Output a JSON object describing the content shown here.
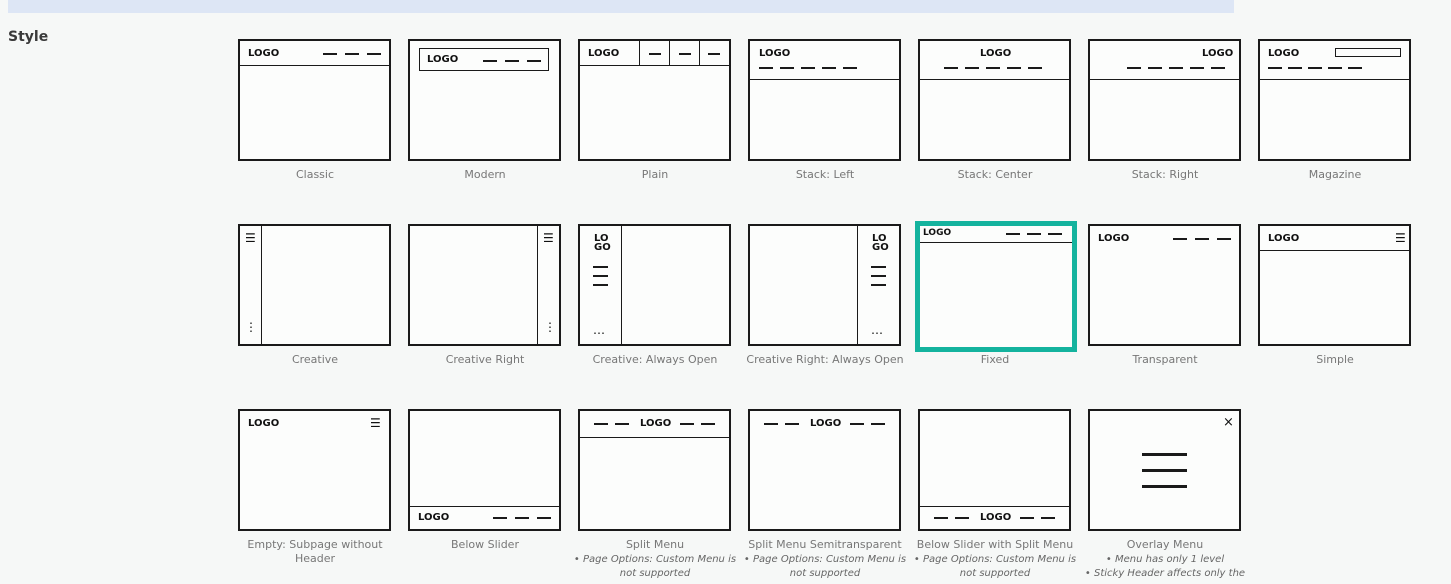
{
  "section": {
    "title": "Style"
  },
  "thumb_logo": "LOGO",
  "thumb_logo_split": [
    "LO",
    "GO"
  ],
  "styles": [
    {
      "id": "classic",
      "label": "Classic"
    },
    {
      "id": "modern",
      "label": "Modern"
    },
    {
      "id": "plain",
      "label": "Plain"
    },
    {
      "id": "stack-left",
      "label": "Stack: Left"
    },
    {
      "id": "stack-center",
      "label": "Stack: Center"
    },
    {
      "id": "stack-right",
      "label": "Stack: Right"
    },
    {
      "id": "magazine",
      "label": "Magazine"
    },
    {
      "id": "creative",
      "label": "Creative"
    },
    {
      "id": "creative-right",
      "label": "Creative Right"
    },
    {
      "id": "creative-always-open",
      "label": "Creative: Always Open"
    },
    {
      "id": "creative-right-always-open",
      "label": "Creative Right: Always Open"
    },
    {
      "id": "fixed",
      "label": "Fixed",
      "selected": true
    },
    {
      "id": "transparent",
      "label": "Transparent"
    },
    {
      "id": "simple",
      "label": "Simple"
    },
    {
      "id": "empty-subpage",
      "label": "Empty: Subpage without",
      "label2": "Header"
    },
    {
      "id": "below-slider",
      "label": "Below Slider"
    },
    {
      "id": "split-menu",
      "label": "Split Menu",
      "notes": [
        "• Page Options: Custom Menu is",
        "not supported"
      ]
    },
    {
      "id": "split-menu-semitransparent",
      "label": "Split Menu Semitransparent",
      "notes": [
        "• Page Options: Custom Menu is",
        "not supported"
      ]
    },
    {
      "id": "below-slider-split-menu",
      "label": "Below Slider with Split Menu",
      "notes": [
        "• Page Options: Custom Menu is",
        "not supported"
      ]
    },
    {
      "id": "overlay-menu",
      "label": "Overlay Menu",
      "notes": [
        "• Menu has only 1 level",
        "• Sticky Header affects only the"
      ]
    }
  ],
  "icons": {
    "hamburger": "☰",
    "dots-vertical": "⋮",
    "dots-horizontal": "⋯",
    "close": "×"
  },
  "colors": {
    "selected_border": "#14b39e",
    "frame": "#1a1a1a",
    "caption": "#777777",
    "top_bar": "#dde6f5"
  }
}
